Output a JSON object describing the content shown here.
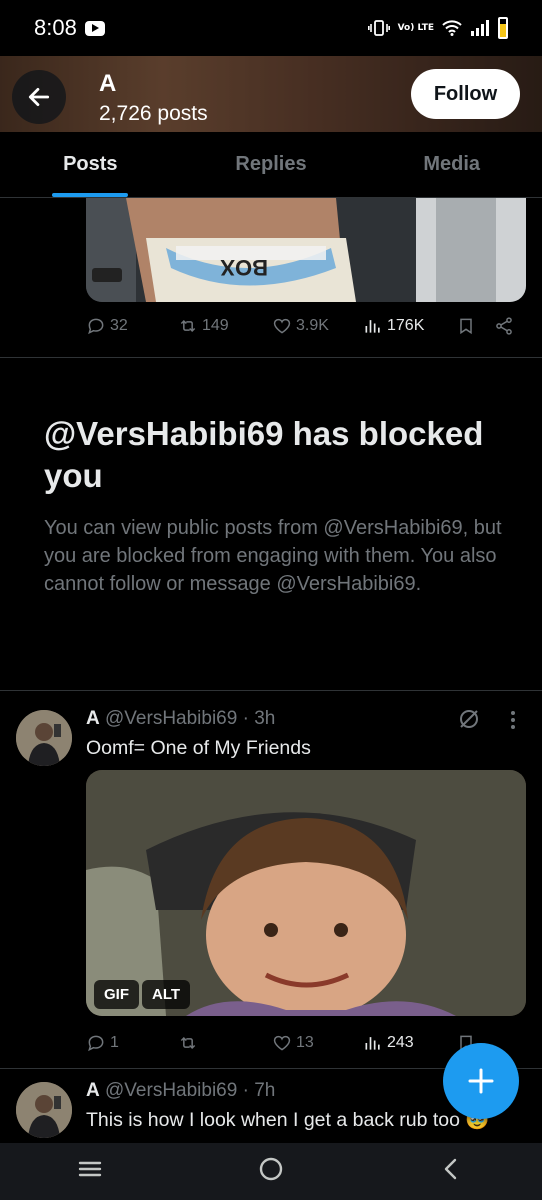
{
  "status_bar": {
    "time": "8:08",
    "volte_label": "Vo) LTE"
  },
  "header": {
    "name": "A",
    "post_count": "2,726 posts",
    "follow_label": "Follow"
  },
  "tabs": [
    {
      "label": "Posts",
      "active": true
    },
    {
      "label": "Replies",
      "active": false
    },
    {
      "label": "Media",
      "active": false
    }
  ],
  "first_post": {
    "image_text": "BOX",
    "replies": "32",
    "reposts": "149",
    "likes": "3.9K",
    "views": "176K"
  },
  "blocked": {
    "title": "@VersHabibi69 has blocked you",
    "body": "You can view public posts from @VersHabibi69, but you are blocked from engaging with them. You also cannot follow or message @VersHabibi69."
  },
  "tweets": [
    {
      "name": "A",
      "handle": "@VersHabibi69",
      "time": "· 3h",
      "text": "Oomf= One of My Friends",
      "media_badges": [
        "GIF",
        "ALT"
      ],
      "replies": "1",
      "reposts": "",
      "likes": "13",
      "views": "243"
    },
    {
      "name": "A",
      "handle": "@VersHabibi69",
      "time": "· 7h",
      "text": "This is how I look when I get a back rub too 🥹"
    }
  ],
  "colors": {
    "accent": "#1d9bf0",
    "background": "#000000",
    "muted": "#71767b",
    "divider": "#2f3336"
  }
}
